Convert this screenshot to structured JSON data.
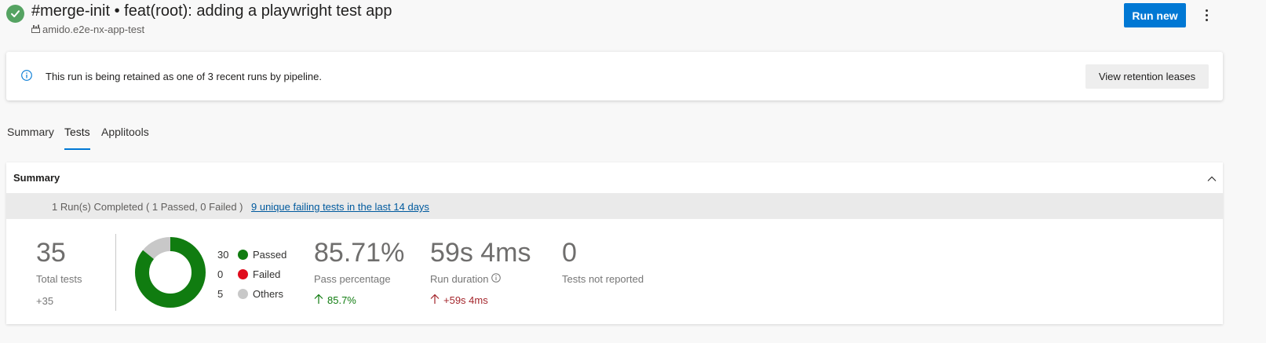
{
  "header": {
    "title": "#merge-init • feat(root): adding a playwright test app",
    "repo": "amido.e2e-nx-app-test",
    "run_new_label": "Run new"
  },
  "banner": {
    "message": "This run is being retained as one of 3 recent runs by pipeline.",
    "button_label": "View retention leases"
  },
  "tabs": [
    {
      "label": "Summary",
      "active": false
    },
    {
      "label": "Tests",
      "active": true
    },
    {
      "label": "Applitools",
      "active": false
    }
  ],
  "summary": {
    "title": "Summary",
    "run_status": "1 Run(s) Completed ( 1 Passed, 0 Failed )",
    "failing_link": "9 unique failing tests in the last 14 days",
    "total_tests": {
      "value": "35",
      "label": "Total tests",
      "delta": "+35"
    },
    "legend": [
      {
        "count": "30",
        "label": "Passed",
        "color": "#107c10",
        "value": 30
      },
      {
        "count": "0",
        "label": "Failed",
        "color": "#e00b1c",
        "value": 0
      },
      {
        "count": "5",
        "label": "Others",
        "color": "#c8c8c8",
        "value": 5
      }
    ],
    "pass_percentage": {
      "value": "85.71%",
      "label": "Pass percentage",
      "delta": "85.7%"
    },
    "run_duration": {
      "value": "59s 4ms",
      "label": "Run duration",
      "delta": "+59s 4ms"
    },
    "not_reported": {
      "value": "0",
      "label": "Tests not reported"
    }
  },
  "colors": {
    "accent": "#0078d4",
    "success": "#107c10",
    "danger": "#a4262c",
    "status_icon": "#55a362"
  },
  "icons": {
    "status": "check-circle-icon",
    "repo": "repo-icon",
    "info": "info-icon",
    "more": "more-vertical-icon",
    "collapse": "chevron-up-icon"
  }
}
